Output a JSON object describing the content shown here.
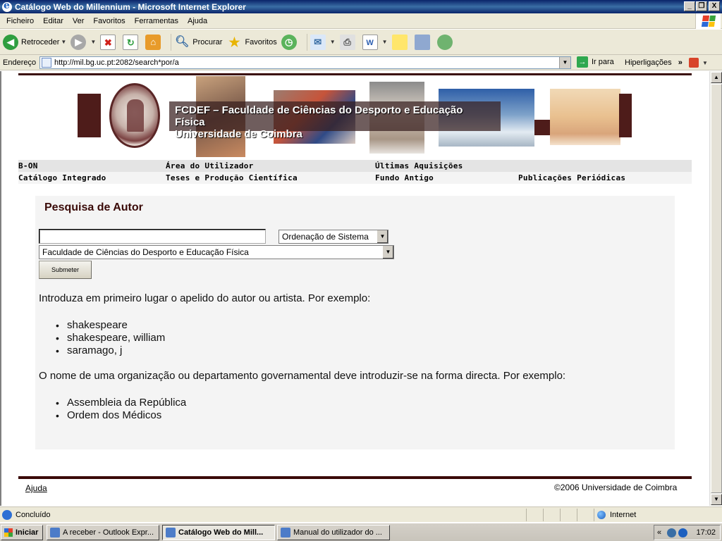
{
  "window": {
    "title": "Catálogo Web do Millennium - Microsoft Internet Explorer",
    "minimize": "_",
    "maximize": "❐",
    "close": "X"
  },
  "menubar": {
    "items": [
      "Ficheiro",
      "Editar",
      "Ver",
      "Favoritos",
      "Ferramentas",
      "Ajuda"
    ]
  },
  "toolbar": {
    "back_label": "Retroceder",
    "search_label": "Procurar",
    "favorites_label": "Favoritos"
  },
  "addressbar": {
    "label": "Endereço",
    "url": "http://mil.bg.uc.pt:2082/search*por/a",
    "go_label": "Ir para",
    "links_label": "Hiperligações"
  },
  "banner": {
    "line1": "FCDEF  –  Faculdade de Ciências do Desporto e Educação Física",
    "line2": "Universidade de Coimbra"
  },
  "nav": {
    "row1": [
      "B-ON",
      "Área do Utilizador",
      "Últimas Aquisições"
    ],
    "row2": [
      "Catálogo Integrado",
      "Teses e Produção Científica",
      "Fundo Antigo",
      "Publicações Periódicas"
    ]
  },
  "search": {
    "title": "Pesquisa de Autor",
    "query_value": "",
    "sort_selected": "Ordenação de Sistema",
    "library_selected": "Faculdade de Ciências do Desporto e Educação Física",
    "submit_label": "Submeter"
  },
  "help": {
    "intro_author": "Introduza em primeiro lugar o apelido do autor ou artista. Por exemplo:",
    "author_examples": [
      "shakespeare",
      "shakespeare, william",
      "saramago, j"
    ],
    "intro_org": "O nome de uma organização ou departamento governamental deve introduzir-se na forma directa. Por exemplo:",
    "org_examples": [
      "Assembleia da República",
      "Ordem dos Médicos"
    ]
  },
  "footer": {
    "help_link": "Ajuda",
    "copyright": "©2006 Universidade de Coimbra"
  },
  "statusbar": {
    "status": "Concluído",
    "zone": "Internet"
  },
  "taskbar": {
    "start": "Iniciar",
    "tasks": [
      "A receber - Outlook Expr...",
      "Catálogo Web do Mill...",
      "Manual do utilizador do ..."
    ],
    "clock": "17:02"
  },
  "colors": {
    "accent": "#3a0a08",
    "titlebar": "#0a246a",
    "panel": "#f4f4f4"
  }
}
